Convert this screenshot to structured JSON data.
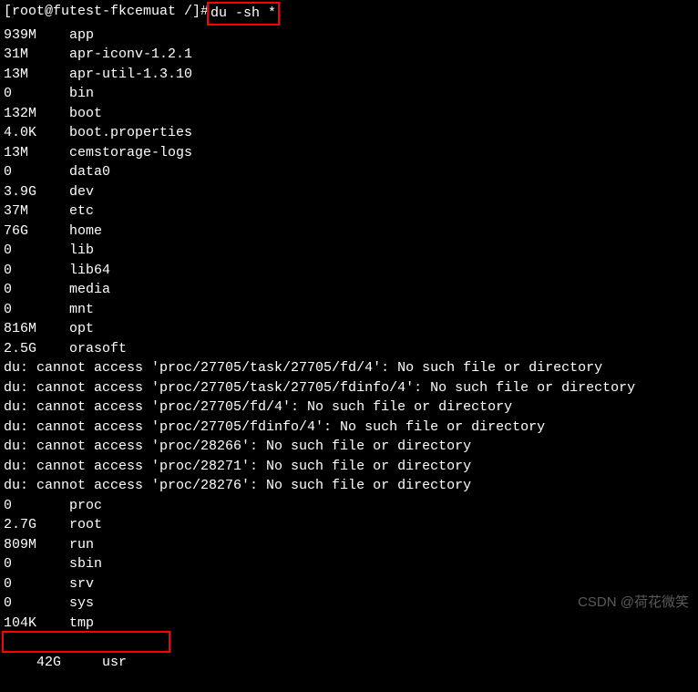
{
  "prompt": {
    "prefix": "[root@futest-fkcemuat /]# ",
    "command": "du -sh *"
  },
  "entries": [
    {
      "size": "939M",
      "name": "app"
    },
    {
      "size": "31M",
      "name": "apr-iconv-1.2.1"
    },
    {
      "size": "13M",
      "name": "apr-util-1.3.10"
    },
    {
      "size": "0",
      "name": "bin"
    },
    {
      "size": "132M",
      "name": "boot"
    },
    {
      "size": "4.0K",
      "name": "boot.properties"
    },
    {
      "size": "13M",
      "name": "cemstorage-logs"
    },
    {
      "size": "0",
      "name": "data0"
    },
    {
      "size": "3.9G",
      "name": "dev"
    },
    {
      "size": "37M",
      "name": "etc"
    },
    {
      "size": "76G",
      "name": "home"
    },
    {
      "size": "0",
      "name": "lib"
    },
    {
      "size": "0",
      "name": "lib64"
    },
    {
      "size": "0",
      "name": "media"
    },
    {
      "size": "0",
      "name": "mnt"
    },
    {
      "size": "816M",
      "name": "opt"
    },
    {
      "size": "2.5G",
      "name": "orasoft"
    }
  ],
  "errors": [
    "du: cannot access 'proc/27705/task/27705/fd/4': No such file or directory",
    "du: cannot access 'proc/27705/task/27705/fdinfo/4': No such file or directory",
    "du: cannot access 'proc/27705/fd/4': No such file or directory",
    "du: cannot access 'proc/27705/fdinfo/4': No such file or directory",
    "du: cannot access 'proc/28266': No such file or directory",
    "du: cannot access 'proc/28271': No such file or directory",
    "du: cannot access 'proc/28276': No such file or directory"
  ],
  "entries2": [
    {
      "size": "0",
      "name": "proc"
    },
    {
      "size": "2.7G",
      "name": "root"
    },
    {
      "size": "809M",
      "name": "run"
    },
    {
      "size": "0",
      "name": "sbin"
    },
    {
      "size": "0",
      "name": "srv"
    },
    {
      "size": "0",
      "name": "sys"
    },
    {
      "size": "104K",
      "name": "tmp"
    }
  ],
  "last_entry": {
    "size": "42G",
    "name": "usr"
  },
  "watermark": "CSDN @荷花微笑"
}
